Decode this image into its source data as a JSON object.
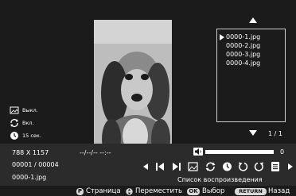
{
  "photo": {
    "subject": "dog"
  },
  "playlist": {
    "items": [
      "0000-1.jpg",
      "0000-2.jpg",
      "0000-3.jpg",
      "0000-4.jpg"
    ],
    "selected_index": 0,
    "page": "1 / 1",
    "label": "Список воспроизведения"
  },
  "settings": {
    "slideshow_effect": "Выкл.",
    "repeat": "Вкл.",
    "interval": "15 сек."
  },
  "info": {
    "resolution": "788 X 1157",
    "date": "--/--/-- --:--",
    "index": "00001 / 00004",
    "filename": "0000-1.jpg",
    "volume": "0"
  },
  "hints": {
    "page_key": "P",
    "page_label": "Страница",
    "move_label": "Переместить",
    "ok_key": "OK",
    "ok_label": "Выбор",
    "return_key": "RETURN",
    "return_label": "Назад"
  },
  "colors": {
    "background": "#1b1b1b",
    "bar": "#2b2b2b",
    "foreground": "#ffffff"
  }
}
